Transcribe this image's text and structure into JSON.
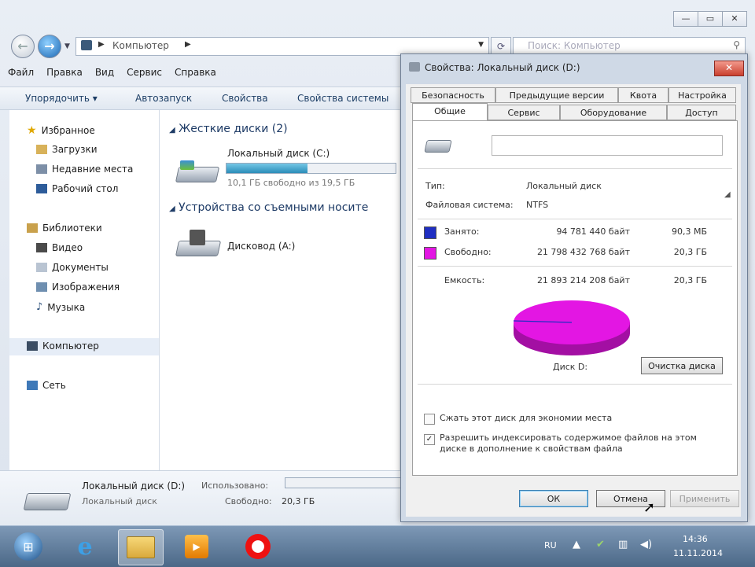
{
  "explorer": {
    "address": {
      "crumb": "Компьютер"
    },
    "search_placeholder": "Поиск: Компьютер",
    "menu": [
      "Файл",
      "Правка",
      "Вид",
      "Сервис",
      "Справка"
    ],
    "toolbar": {
      "organize": "Упорядочить ▾",
      "autoplay": "Автозапуск",
      "properties": "Свойства",
      "system_properties": "Свойства системы"
    },
    "nav": {
      "favorites": "Избранное",
      "downloads": "Загрузки",
      "recent": "Недавние места",
      "desktop": "Рабочий стол",
      "libraries": "Библиотеки",
      "video": "Видео",
      "documents": "Документы",
      "images": "Изображения",
      "music": "Музыка",
      "computer": "Компьютер",
      "network": "Сеть"
    },
    "groups": {
      "hdd": "Жесткие диски (2)",
      "removable": "Устройства со съемными носите"
    },
    "drive_c": {
      "name": "Локальный диск (C:)",
      "free": "10,1 ГБ свободно из 19,5 ГБ",
      "used_fraction": 0.48
    },
    "floppy": {
      "name": "Дисковод (A:)"
    },
    "details": {
      "name": "Локальный диск (D:)",
      "type": "Локальный диск",
      "used_label": "Использовано:",
      "free_label": "Свободно:",
      "free_value": "20,3 ГБ"
    }
  },
  "dialog": {
    "title": "Свойства: Локальный диск (D:)",
    "close": "✕",
    "tabs_top": [
      "Безопасность",
      "Предыдущие версии",
      "Квота",
      "Настройка"
    ],
    "tabs_bottom": [
      "Общие",
      "Сервис",
      "Оборудование",
      "Доступ"
    ],
    "type_label": "Тип:",
    "type_value": "Локальный диск",
    "fs_label": "Файловая система:",
    "fs_value": "NTFS",
    "used_label": "Занято:",
    "used_bytes": "94 781 440 байт",
    "used_size": "90,3 МБ",
    "free_label": "Свободно:",
    "free_bytes": "21 798 432 768 байт",
    "free_size": "20,3 ГБ",
    "capacity_label": "Емкость:",
    "capacity_bytes": "21 893 214 208 байт",
    "capacity_size": "20,3 ГБ",
    "drive_label": "Диск D:",
    "cleanup": "Очистка диска",
    "compress": "Сжать этот диск для экономии места",
    "index": "Разрешить индексировать содержимое файлов на этом диске в дополнение к свойствам файла",
    "ok": "ОК",
    "cancel": "Отмена",
    "apply": "Применить",
    "used_color": "#1f2ec2",
    "free_color": "#e316e3"
  },
  "taskbar": {
    "lang": "RU",
    "time": "14:36",
    "date": "11.11.2014"
  }
}
